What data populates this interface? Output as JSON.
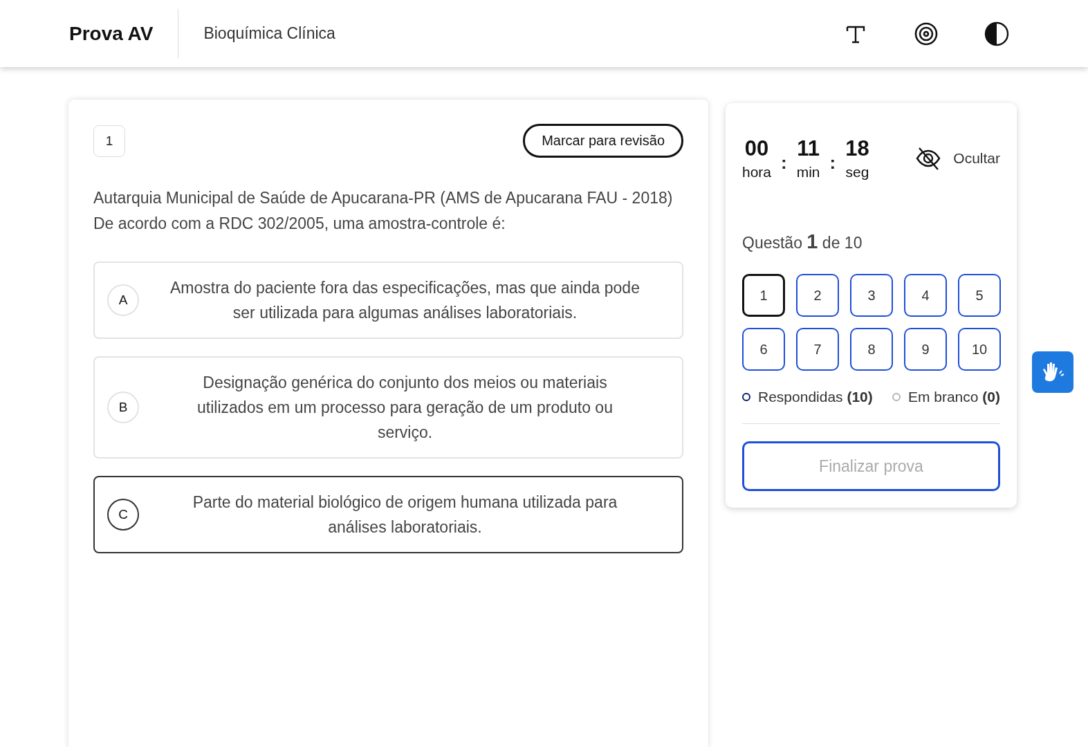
{
  "header": {
    "title": "Prova AV",
    "subtitle": "Bioquímica Clínica"
  },
  "question": {
    "number": "1",
    "review_button": "Marcar para revisão",
    "text": "Autarquia Municipal de Saúde de Apucarana-PR (AMS de Apucarana FAU - 2018) De acordo com a RDC 302/2005, uma amostra-controle é:",
    "options": [
      {
        "letter": "A",
        "text": "Amostra do paciente fora das especificações, mas que ainda pode ser utilizada para algumas análises laboratoriais.",
        "selected": false
      },
      {
        "letter": "B",
        "text": "Designação genérica do conjunto dos meios ou materiais utilizados em um processo para geração de um produto ou serviço.",
        "selected": false
      },
      {
        "letter": "C",
        "text": "Parte do material biológico de origem humana utilizada para análises laboratoriais.",
        "selected": true
      }
    ]
  },
  "timer": {
    "units": [
      {
        "value": "00",
        "label": "hora"
      },
      {
        "value": "11",
        "label": "min"
      },
      {
        "value": "18",
        "label": "seg"
      }
    ],
    "separators": [
      ":",
      ":"
    ],
    "hide_label": "Ocultar"
  },
  "progress": "Questão **1** de 10",
  "nav": [
    {
      "label": "1",
      "selected": true,
      "answered": true
    },
    {
      "label": "2",
      "selected": false,
      "answered": true
    },
    {
      "label": "3",
      "selected": false,
      "answered": true
    },
    {
      "label": "4",
      "selected": false,
      "answered": true
    },
    {
      "label": "5",
      "selected": false,
      "answered": true
    },
    {
      "label": "6",
      "selected": false,
      "answered": true
    },
    {
      "label": "7",
      "selected": false,
      "answered": true
    },
    {
      "label": "8",
      "selected": false,
      "answered": true
    },
    {
      "label": "9",
      "selected": false,
      "answered": true
    },
    {
      "label": "10",
      "selected": false,
      "answered": true
    }
  ],
  "legend": [
    {
      "label": "Respondidas **(10)**",
      "color": "#0b1f6b"
    },
    {
      "label": "Em branco **(0)**",
      "color": "#b5b5b5"
    }
  ],
  "finish_button": {
    "label": "Finalizar prova",
    "disabled": true
  }
}
